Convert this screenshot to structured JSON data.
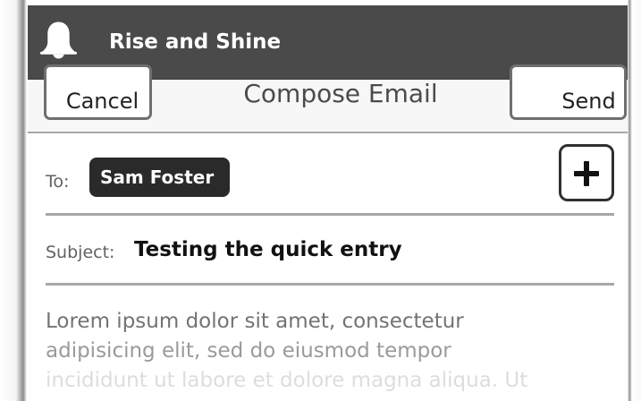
{
  "app": {
    "title": "Rise and Shine",
    "icon": "bell-icon"
  },
  "compose": {
    "cancel_label": "Cancel",
    "title": "Compose Email",
    "send_label": "Send"
  },
  "recipient": {
    "label": "To:",
    "name": "Sam Foster",
    "add_icon": "plus-icon"
  },
  "subject": {
    "label": "Subject:",
    "value": "Testing the quick entry"
  },
  "message": {
    "lines": [
      "Lorem ipsum dolor sit amet, consectetur",
      "adipisicing elit, sed do eiusmod tempor",
      "incididunt ut labore et dolore magna aliqua. Ut"
    ]
  },
  "colors": {
    "status_bar": "#4a4a4a",
    "chip": "#2a2a2a",
    "divider": "#a7a7a7",
    "body_text": "#777777"
  }
}
